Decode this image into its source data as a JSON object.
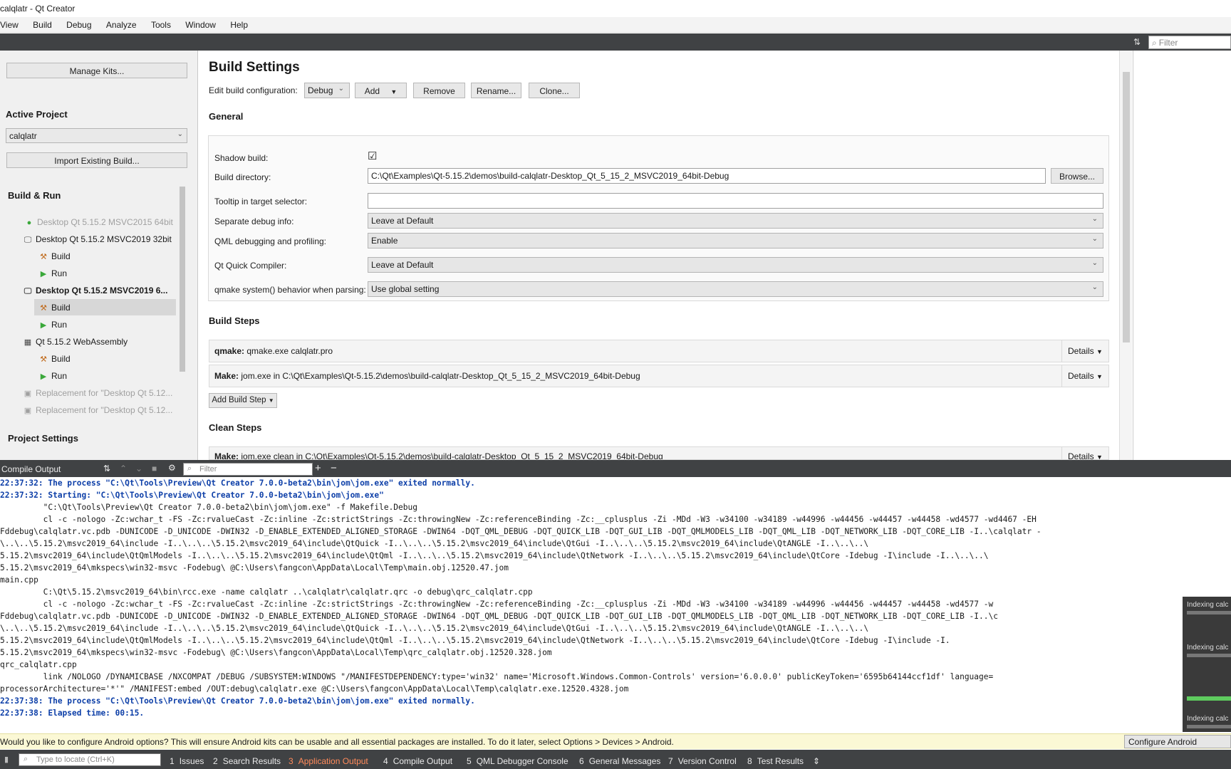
{
  "window": {
    "title": "calqlatr - Qt Creator"
  },
  "menu": [
    "View",
    "Build",
    "Debug",
    "Analyze",
    "Tools",
    "Window",
    "Help"
  ],
  "top_filter": {
    "placeholder": "Filter"
  },
  "left": {
    "manage_kits": "Manage Kits...",
    "active_project_title": "Active Project",
    "project_combo": "calqlatr",
    "import_existing": "Import Existing Build...",
    "build_run_title": "Build & Run",
    "kits": [
      {
        "label": "Desktop Qt 5.15.2 MSVC2015 64bit"
      },
      {
        "label": "Desktop Qt 5.15.2 MSVC2019 32bit"
      },
      {
        "label": "Build"
      },
      {
        "label": "Run"
      },
      {
        "label": "Desktop Qt 5.15.2 MSVC2019 6..."
      },
      {
        "label": "Build"
      },
      {
        "label": "Run"
      },
      {
        "label": "Qt 5.15.2 WebAssembly"
      },
      {
        "label": "Build"
      },
      {
        "label": "Run"
      },
      {
        "label": "Replacement for \"Desktop Qt 5.12..."
      },
      {
        "label": "Replacement for \"Desktop Qt 5.12..."
      }
    ],
    "project_settings_title": "Project Settings"
  },
  "build_settings": {
    "title": "Build Settings",
    "edit_config_label": "Edit build configuration:",
    "config_value": "Debug",
    "add": "Add",
    "remove": "Remove",
    "rename": "Rename...",
    "clone": "Clone...",
    "general_title": "General",
    "shadow_build_label": "Shadow build:",
    "shadow_build_check": "☑",
    "build_dir_label": "Build directory:",
    "build_dir_value": "C:\\Qt\\Examples\\Qt-5.15.2\\demos\\build-calqlatr-Desktop_Qt_5_15_2_MSVC2019_64bit-Debug",
    "browse": "Browse...",
    "tooltip_label": "Tooltip in target selector:",
    "tooltip_value": "",
    "sep_debug_label": "Separate debug info:",
    "sep_debug_value": "Leave at Default",
    "qml_debug_label": "QML debugging and profiling:",
    "qml_debug_value": "Enable",
    "quick_compiler_label": "Qt Quick Compiler:",
    "quick_compiler_value": "Leave at Default",
    "qmake_system_label": "qmake system() behavior when parsing:",
    "qmake_system_value": "Use global setting",
    "build_steps_title": "Build Steps",
    "step_qmake_bold": "qmake:",
    "step_qmake_rest": " qmake.exe calqlatr.pro",
    "step_make_bold": "Make:",
    "step_make_rest": " jom.exe in C:\\Qt\\Examples\\Qt-5.15.2\\demos\\build-calqlatr-Desktop_Qt_5_15_2_MSVC2019_64bit-Debug",
    "details": "Details",
    "add_build_step": "Add Build Step",
    "clean_steps_title": "Clean Steps",
    "clean_make_bold": "Make:",
    "clean_make_rest": " jom.exe clean in C:\\Qt\\Examples\\Qt-5.15.2\\demos\\build-calqlatr-Desktop_Qt_5_15_2_MSVC2019_64bit-Debug"
  },
  "output": {
    "title": "Compile Output",
    "filter_placeholder": "Filter",
    "lines": [
      {
        "text": "22:37:32: The process \"C:\\Qt\\Tools\\Preview\\Qt Creator 7.0.0-beta2\\bin\\jom\\jom.exe\" exited normally.",
        "kind": "blue"
      },
      {
        "text": "22:37:32: Starting: \"C:\\Qt\\Tools\\Preview\\Qt Creator 7.0.0-beta2\\bin\\jom\\jom.exe\"",
        "kind": "blue"
      },
      {
        "text": "         \"C:\\Qt\\Tools\\Preview\\Qt Creator 7.0.0-beta2\\bin\\jom\\jom.exe\" -f Makefile.Debug",
        "kind": "plain"
      },
      {
        "text": "         cl -c -nologo -Zc:wchar_t -FS -Zc:rvalueCast -Zc:inline -Zc:strictStrings -Zc:throwingNew -Zc:referenceBinding -Zc:__cplusplus -Zi -MDd -W3 -w34100 -w34189 -w44996 -w44456 -w44457 -w44458 -wd4577 -wd4467 -EH",
        "kind": "plain"
      },
      {
        "text": "Fddebug\\calqlatr.vc.pdb -DUNICODE -D_UNICODE -DWIN32 -D_ENABLE_EXTENDED_ALIGNED_STORAGE -DWIN64 -DQT_QML_DEBUG -DQT_QUICK_LIB -DQT_GUI_LIB -DQT_QMLMODELS_LIB -DQT_QML_LIB -DQT_NETWORK_LIB -DQT_CORE_LIB -I..\\calqlatr -",
        "kind": "plain"
      },
      {
        "text": "\\..\\..\\5.15.2\\msvc2019_64\\include -I..\\..\\..\\5.15.2\\msvc2019_64\\include\\QtQuick -I..\\..\\..\\5.15.2\\msvc2019_64\\include\\QtGui -I..\\..\\..\\5.15.2\\msvc2019_64\\include\\QtANGLE -I..\\..\\..\\",
        "kind": "plain"
      },
      {
        "text": "5.15.2\\msvc2019_64\\include\\QtQmlModels -I..\\..\\..\\5.15.2\\msvc2019_64\\include\\QtQml -I..\\..\\..\\5.15.2\\msvc2019_64\\include\\QtNetwork -I..\\..\\..\\5.15.2\\msvc2019_64\\include\\QtCore -Idebug -I\\include -I..\\..\\..\\",
        "kind": "plain"
      },
      {
        "text": "5.15.2\\msvc2019_64\\mkspecs\\win32-msvc -Fodebug\\ @C:\\Users\\fangcon\\AppData\\Local\\Temp\\main.obj.12520.47.jom",
        "kind": "plain"
      },
      {
        "text": "main.cpp",
        "kind": "plain"
      },
      {
        "text": "         C:\\Qt\\5.15.2\\msvc2019_64\\bin\\rcc.exe -name calqlatr ..\\calqlatr\\calqlatr.qrc -o debug\\qrc_calqlatr.cpp",
        "kind": "plain"
      },
      {
        "text": "         cl -c -nologo -Zc:wchar_t -FS -Zc:rvalueCast -Zc:inline -Zc:strictStrings -Zc:throwingNew -Zc:referenceBinding -Zc:__cplusplus -Zi -MDd -W3 -w34100 -w34189 -w44996 -w44456 -w44457 -w44458 -wd4577 -w",
        "kind": "plain"
      },
      {
        "text": "Fddebug\\calqlatr.vc.pdb -DUNICODE -D_UNICODE -DWIN32 -D_ENABLE_EXTENDED_ALIGNED_STORAGE -DWIN64 -DQT_QML_DEBUG -DQT_QUICK_LIB -DQT_GUI_LIB -DQT_QMLMODELS_LIB -DQT_QML_LIB -DQT_NETWORK_LIB -DQT_CORE_LIB -I..\\c",
        "kind": "plain"
      },
      {
        "text": "\\..\\..\\5.15.2\\msvc2019_64\\include -I..\\..\\..\\5.15.2\\msvc2019_64\\include\\QtQuick -I..\\..\\..\\5.15.2\\msvc2019_64\\include\\QtGui -I..\\..\\..\\5.15.2\\msvc2019_64\\include\\QtANGLE -I..\\..\\..\\",
        "kind": "plain"
      },
      {
        "text": "5.15.2\\msvc2019_64\\include\\QtQmlModels -I..\\..\\..\\5.15.2\\msvc2019_64\\include\\QtQml -I..\\..\\..\\5.15.2\\msvc2019_64\\include\\QtNetwork -I..\\..\\..\\5.15.2\\msvc2019_64\\include\\QtCore -Idebug -I\\include -I.",
        "kind": "plain"
      },
      {
        "text": "5.15.2\\msvc2019_64\\mkspecs\\win32-msvc -Fodebug\\ @C:\\Users\\fangcon\\AppData\\Local\\Temp\\qrc_calqlatr.obj.12520.328.jom",
        "kind": "plain"
      },
      {
        "text": "qrc_calqlatr.cpp",
        "kind": "plain"
      },
      {
        "text": "         link /NOLOGO /DYNAMICBASE /NXCOMPAT /DEBUG /SUBSYSTEM:WINDOWS \"/MANIFESTDEPENDENCY:type='win32' name='Microsoft.Windows.Common-Controls' version='6.0.0.0' publicKeyToken='6595b64144ccf1df' language=",
        "kind": "plain"
      },
      {
        "text": "processorArchitecture='*'\" /MANIFEST:embed /OUT:debug\\calqlatr.exe @C:\\Users\\fangcon\\AppData\\Local\\Temp\\calqlatr.exe.12520.4328.jom",
        "kind": "plain"
      },
      {
        "text": "22:37:38: The process \"C:\\Qt\\Tools\\Preview\\Qt Creator 7.0.0-beta2\\bin\\jom\\jom.exe\" exited normally.",
        "kind": "blue"
      },
      {
        "text": "22:37:38: Elapsed time: 00:15.",
        "kind": "blue"
      }
    ]
  },
  "indexing": [
    "Indexing calc",
    "Indexing calc",
    "Indexing calc"
  ],
  "notice": {
    "text": "Would you like to configure Android options? This will ensure Android kits can be usable and all essential packages are installed. To do it later, select Options > Devices > Android.",
    "configure_button": "Configure Android"
  },
  "statusbar": {
    "locate_placeholder": "Type to locate (Ctrl+K)",
    "tabs": [
      {
        "num": "1",
        "label": "Issues"
      },
      {
        "num": "2",
        "label": "Search Results"
      },
      {
        "num": "3",
        "label": "Application Output"
      },
      {
        "num": "4",
        "label": "Compile Output"
      },
      {
        "num": "5",
        "label": "QML Debugger Console"
      },
      {
        "num": "6",
        "label": "General Messages"
      },
      {
        "num": "7",
        "label": "Version Control"
      },
      {
        "num": "8",
        "label": "Test Results"
      }
    ]
  }
}
